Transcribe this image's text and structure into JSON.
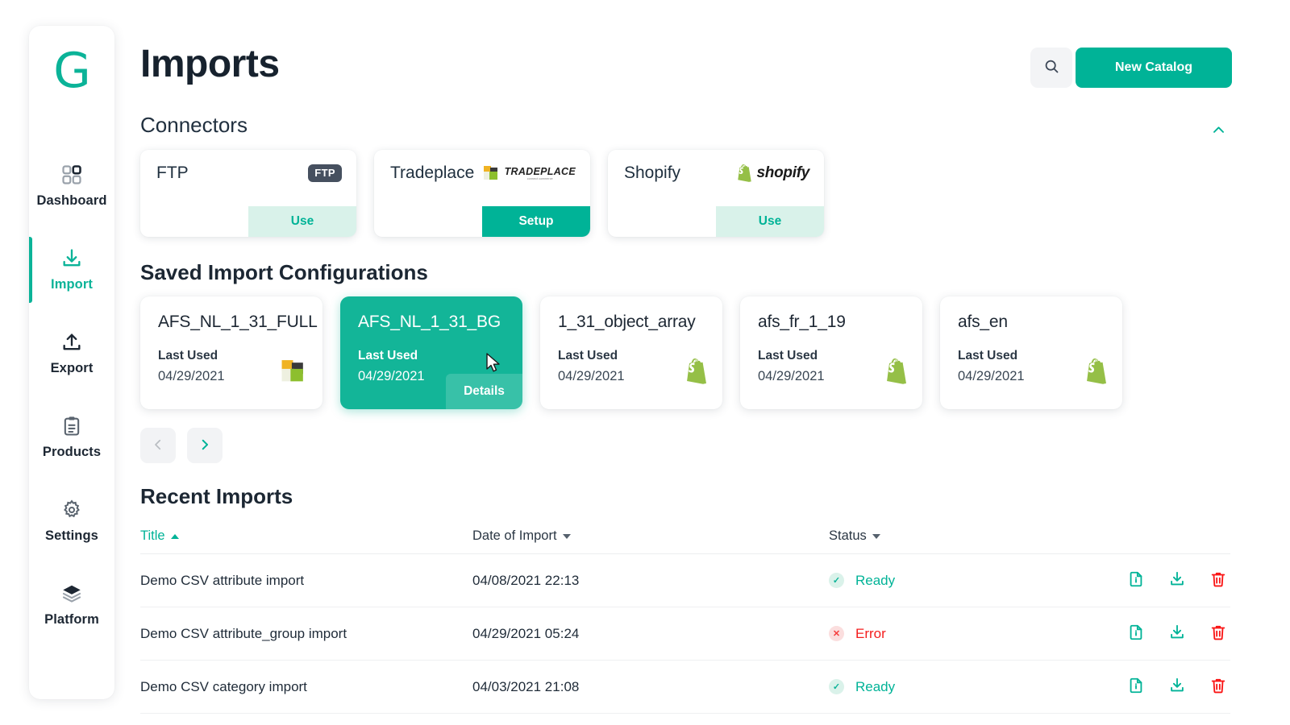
{
  "header": {
    "page_title": "Imports",
    "search_icon": "search-icon",
    "new_catalog_label": "New Catalog"
  },
  "sidebar": {
    "brand": "G",
    "items": [
      {
        "label": "Dashboard",
        "icon": "dashboard-grid-icon",
        "active": false
      },
      {
        "label": "Import",
        "icon": "download-tray-icon",
        "active": true
      },
      {
        "label": "Export",
        "icon": "upload-tray-icon",
        "active": false
      },
      {
        "label": "Products",
        "icon": "clipboard-icon",
        "active": false
      },
      {
        "label": "Settings",
        "icon": "gear-icon",
        "active": false
      },
      {
        "label": "Platform",
        "icon": "layers-icon",
        "active": false
      }
    ]
  },
  "connectors": {
    "heading": "Connectors",
    "collapse_icon": "chevron-up-icon",
    "cards": [
      {
        "name": "FTP",
        "logo": "ftp-badge-icon",
        "logo_text": "FTP",
        "action": "Use",
        "action_style": "use"
      },
      {
        "name": "Tradeplace",
        "logo": "tradeplace-logo-icon",
        "logo_text": "TRADEPLACE",
        "logo_sub": "connect commerce",
        "action": "Setup",
        "action_style": "setup"
      },
      {
        "name": "Shopify",
        "logo": "shopify-logo-icon",
        "logo_text": "shopify",
        "action": "Use",
        "action_style": "use"
      }
    ]
  },
  "saved_configs": {
    "heading": "Saved Import Configurations",
    "last_used_label": "Last Used",
    "details_label": "Details",
    "cards": [
      {
        "name": "AFS_NL_1_31_FULL",
        "date": "04/29/2021",
        "logo": "tradeplace-logo-icon",
        "selected": false
      },
      {
        "name": "AFS_NL_1_31_BG",
        "date": "04/29/2021",
        "logo": "none",
        "selected": true
      },
      {
        "name": "1_31_object_array",
        "date": "04/29/2021",
        "logo": "shopify-bag-icon",
        "selected": false
      },
      {
        "name": "afs_fr_1_19",
        "date": "04/29/2021",
        "logo": "shopify-bag-icon",
        "selected": false
      },
      {
        "name": "afs_en",
        "date": "04/29/2021",
        "logo": "shopify-bag-icon",
        "selected": false
      }
    ],
    "pager": {
      "prev_icon": "chevron-left-icon",
      "next_icon": "chevron-right-icon"
    }
  },
  "recent_imports": {
    "heading": "Recent Imports",
    "columns": [
      {
        "label": "Title",
        "sort": "asc"
      },
      {
        "label": "Date of Import",
        "sort": "desc"
      },
      {
        "label": "Status",
        "sort": "desc"
      }
    ],
    "rows": [
      {
        "title": "Demo CSV attribute import",
        "date": "04/08/2021 22:13",
        "status": "Ready",
        "status_type": "ok"
      },
      {
        "title": "Demo CSV attribute_group import",
        "date": "04/29/2021 05:24",
        "status": "Error",
        "status_type": "err"
      },
      {
        "title": "Demo CSV category import",
        "date": "04/03/2021 21:08",
        "status": "Ready",
        "status_type": "ok"
      }
    ],
    "row_actions": [
      {
        "icon": "file-info-icon",
        "color": "#00b397"
      },
      {
        "icon": "download-icon",
        "color": "#00b397"
      },
      {
        "icon": "trash-icon",
        "color": "#fa1414"
      }
    ]
  },
  "colors": {
    "accent": "#00b397",
    "accent_selected": "#13b598",
    "error": "#f41d1d",
    "text_dark": "#1d2733",
    "chip_bg": "#f2f3f5"
  }
}
